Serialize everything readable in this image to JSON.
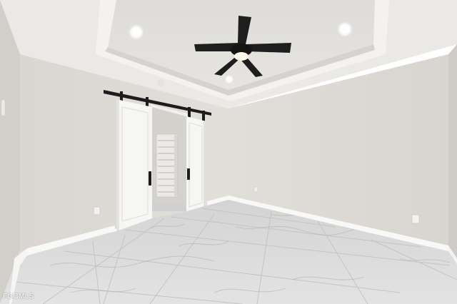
{
  "watermark": {
    "text": "FGCMLS",
    "color": "#ffffff"
  },
  "palette": {
    "wall": "#dedbd6",
    "ceiling": "#eceae6",
    "tray": "#e1dfdb",
    "baseboard": "#f8f8f6",
    "floor": "#d9dad9",
    "door": "#f7f7f5",
    "hardware": "#1d1d1d"
  },
  "icons": [
    "ceiling-fan-icon",
    "recessed-light-icon",
    "electrical-outlet-icon"
  ]
}
